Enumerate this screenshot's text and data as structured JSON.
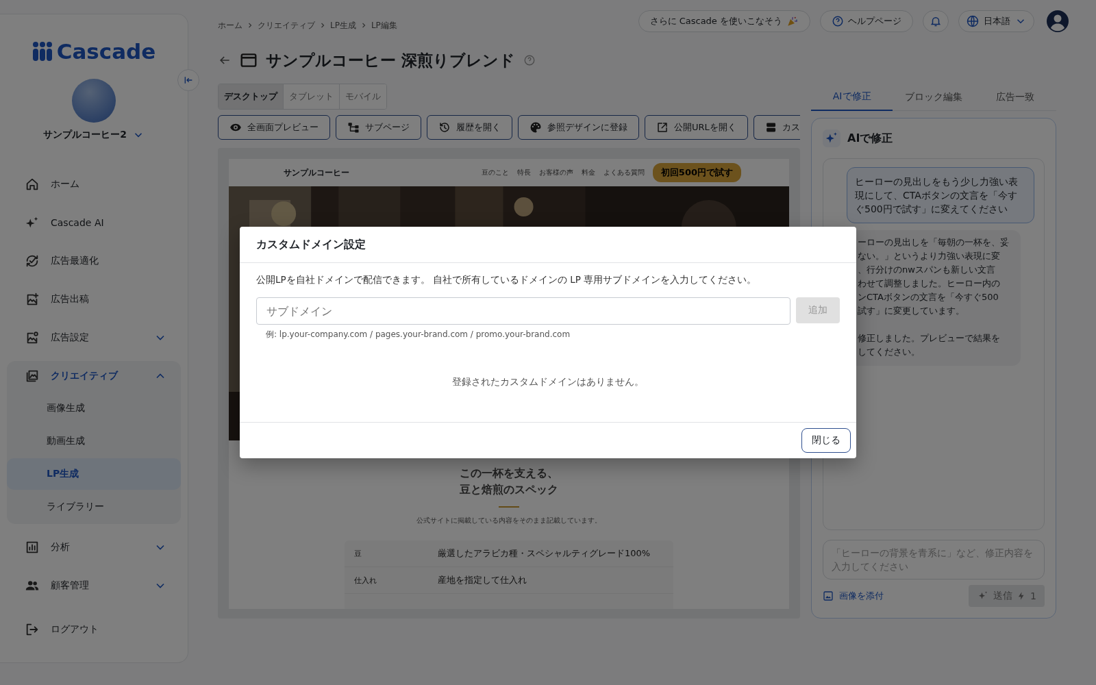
{
  "sidebar": {
    "logo": "Cascade",
    "account": "サンプルコーヒー2",
    "nav": [
      {
        "label": "ホーム",
        "selected": false
      },
      {
        "label": "Cascade AI",
        "selected": false
      },
      {
        "label": "広告最適化",
        "selected": false
      },
      {
        "label": "広告出稿",
        "selected": false
      },
      {
        "label": "広告設定",
        "selected": false,
        "expanded": false
      },
      {
        "label": "クリエイティブ",
        "selected": true,
        "expanded": true,
        "children": [
          {
            "label": "画像生成",
            "selected": false
          },
          {
            "label": "動画生成",
            "selected": false
          },
          {
            "label": "LP生成",
            "selected": true
          },
          {
            "label": "ライブラリー",
            "selected": false
          }
        ]
      },
      {
        "label": "分析",
        "selected": false,
        "expanded": false
      },
      {
        "label": "顧客管理",
        "selected": false,
        "expanded": false
      },
      {
        "label": "ログアウト",
        "selected": false
      }
    ]
  },
  "header": {
    "breadcrumb": [
      "ホーム",
      "クリエイティブ",
      "LP生成",
      "LP編集"
    ],
    "promo": "さらに Cascade を使いこなそう",
    "help": "ヘルプページ",
    "language": "日本語"
  },
  "page_title": "サンプルコーヒー 深煎りブレンド",
  "device_tabs": [
    {
      "label": "デスクトップ",
      "selected": true
    },
    {
      "label": "タブレット",
      "selected": false
    },
    {
      "label": "モバイル",
      "selected": false
    }
  ],
  "toolbar": [
    "全画面プレビュー",
    "サブページ",
    "履歴を開く",
    "参照デザインに登録",
    "公開URLを開く",
    "カス"
  ],
  "preview": {
    "brand": "サンプルコーヒー",
    "nav": [
      "豆のこと",
      "特長",
      "お客様の声",
      "料金",
      "よくある質問"
    ],
    "cta": "初回500円で試す",
    "hero": {
      "kind": "picture"
    },
    "section_title": [
      "この一杯を支える、",
      "豆と焙煎のスペック"
    ],
    "section_note": "公式サイトに掲載している内容をそのまま記載しています。",
    "spec_rows": [
      {
        "label": "豆",
        "value": "厳選したアラビカ種・スペシャルティグレード100%"
      },
      {
        "label": "仕入れ",
        "value": "産地を指定して仕入れ"
      }
    ]
  },
  "right_panel": {
    "tabs": [
      {
        "label": "AIで修正",
        "selected": true
      },
      {
        "label": "ブロック編集",
        "selected": false
      },
      {
        "label": "広告一致",
        "selected": false
      }
    ],
    "title": "AIで修正",
    "messages": [
      {
        "kind": "user",
        "text": "ヒーローの見出しをもう少し力強い表現にして、CTAボタンの文言を「今すぐ500円で試す」に変えてください"
      },
      {
        "kind": "assistant",
        "paragraphs": [
          [
            "ーローの見出しを「毎朝の一杯を、妥",
            "ない。」というより力強い表現に変",
            "、行分けのnwスパンも新しい文言",
            "わせて調整しました。ヒーロー内の",
            "ンCTAボタンの文言を「今すぐ500",
            "試す」に変更しています。"
          ],
          [
            "修正しました。プレビューで結果を",
            "してください。"
          ]
        ]
      }
    ],
    "input_placeholder": "「ヒーローの背景を青系に」など、修正内容を入力してください",
    "attach": "画像を添付",
    "send": {
      "label": "送信",
      "cost": "1",
      "disabled": true
    }
  },
  "modal": {
    "title": "カスタムドメイン設定",
    "description": "公開LPを自社ドメインで配信できます。 自社で所有しているドメインの LP 専用サブドメインを入力してください。",
    "field_placeholder": "サブドメイン",
    "add": {
      "label": "追加",
      "disabled": true
    },
    "hint": "例: lp.your-company.com / pages.your-brand.com / promo.your-brand.com",
    "empty": "登録されたカスタムドメインはありません。",
    "close": "閉じる"
  }
}
